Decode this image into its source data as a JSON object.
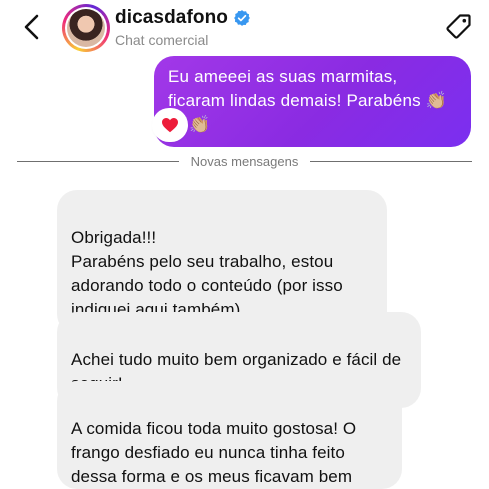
{
  "header": {
    "username": "dicasdafono",
    "subtitle": "Chat comercial",
    "icons": {
      "back": "chevron-left-icon",
      "verified": "verified-badge-icon",
      "tag": "tag-icon"
    },
    "colors": {
      "verified": "#3897f0"
    }
  },
  "messages": {
    "outgoing": {
      "text": "Eu ameeei as suas marmitas, ficaram lindas demais! Parabéns 👏🏼👏🏼👏🏼",
      "reaction": "❤️",
      "colors": {
        "bubble_start": "#a238e8",
        "bubble_end": "#7b2ff0"
      }
    },
    "divider": "Novas mensagens",
    "incoming": [
      {
        "text": "Obrigada!!!\nParabéns pelo seu trabalho, estou adorando todo o conteúdo (por isso indiquei aqui também)"
      },
      {
        "text": "Achei tudo muito bem organizado e fácil de seguir!"
      },
      {
        "text": "A comida ficou toda muito gostosa! O frango desfiado eu nunca tinha feito dessa forma e os meus ficavam bem sem gosto ."
      }
    ]
  }
}
